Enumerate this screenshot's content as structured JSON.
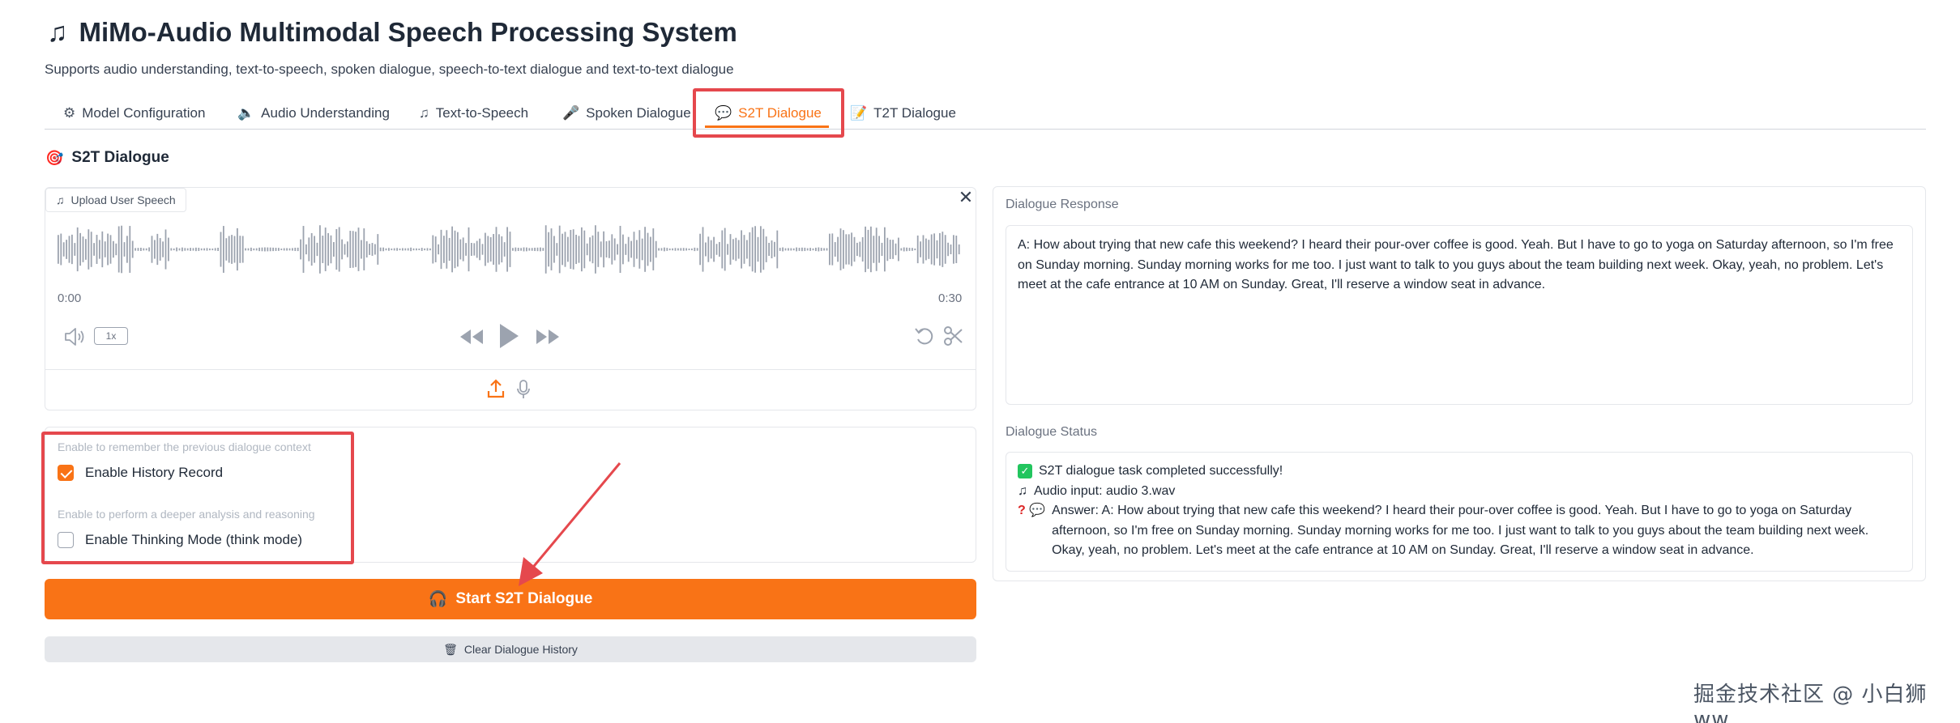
{
  "app": {
    "title": "MiMo-Audio Multimodal Speech Processing System",
    "subtitle": "Supports audio understanding, text-to-speech, spoken dialogue, speech-to-text dialogue and text-to-text dialogue"
  },
  "tabs": [
    {
      "label": "Model Configuration",
      "icon": "gear-icon",
      "active": false
    },
    {
      "label": "Audio Understanding",
      "icon": "speaker-icon",
      "active": false
    },
    {
      "label": "Text-to-Speech",
      "icon": "music-note-icon",
      "active": false
    },
    {
      "label": "Spoken Dialogue",
      "icon": "microphone-icon",
      "active": false
    },
    {
      "label": "S2T Dialogue",
      "icon": "speech-bubble-icon",
      "active": true
    },
    {
      "label": "T2T Dialogue",
      "icon": "memo-icon",
      "active": false
    }
  ],
  "section": {
    "title": "S2T Dialogue",
    "icon": "target-icon"
  },
  "audio": {
    "upload_label": "Upload User Speech",
    "time_start": "0:00",
    "time_end": "0:30",
    "speed": "1x"
  },
  "options": {
    "history_hint": "Enable to remember the previous dialogue context",
    "history_label": "Enable History Record",
    "history_checked": true,
    "thinking_hint": "Enable to perform a deeper analysis and reasoning",
    "thinking_label": "Enable Thinking Mode (think mode)",
    "thinking_checked": false
  },
  "buttons": {
    "start_label": "Start S2T Dialogue",
    "clear_label": "Clear Dialogue History"
  },
  "response": {
    "label": "Dialogue Response",
    "text": "A: How about trying that new cafe this weekend? I heard their pour-over coffee is good. Yeah. But I have to go to yoga on Saturday afternoon, so I'm free on Sunday morning. Sunday morning works for me too. I just want to talk to you guys about the team building next week. Okay, yeah, no problem. Let's meet at the cafe entrance at 10 AM on Sunday. Great, I'll reserve a window seat in advance."
  },
  "status": {
    "label": "Dialogue Status",
    "line1": "S2T dialogue task completed successfully!",
    "line2": "Audio input: audio 3.wav",
    "line3": "Answer: A: How about trying that new cafe this weekend? I heard their pour-over coffee is good. Yeah. But I have to go to yoga on Saturday afternoon, so I'm free on Sunday morning. Sunday morning works for me too. I just want to talk to you guys about the team building next week. Okay, yeah, no problem. Let's meet at the cafe entrance at 10 AM on Sunday. Great, I'll reserve a window seat in advance."
  },
  "watermark": "掘金技术社区 @ 小白狮ww",
  "colors": {
    "accent": "#f97316",
    "highlight": "#e5484d",
    "success": "#22c55e"
  }
}
